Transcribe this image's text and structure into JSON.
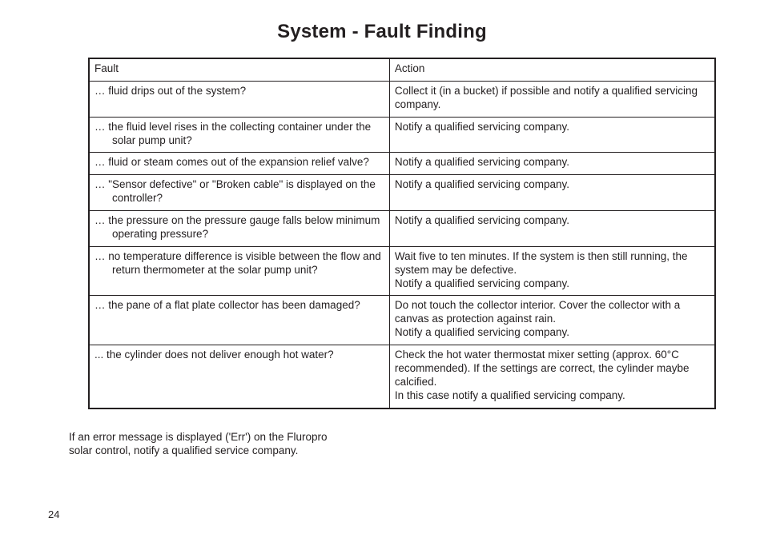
{
  "title": "System - Fault Finding",
  "columns": {
    "fault": "Fault",
    "action": "Action"
  },
  "rows": [
    {
      "fault": "… fluid drips out of the system?",
      "action": "Collect it (in a bucket) if possible and notify a qualified servicing company."
    },
    {
      "fault": "… the fluid level rises in the collecting container under the solar pump unit?",
      "action": "Notify a qualified servicing company."
    },
    {
      "fault": "… fluid or steam comes out of the expansion relief valve?",
      "action": "Notify a qualified servicing company."
    },
    {
      "fault": "… \"Sensor defective\" or \"Broken cable\" is displayed on the controller?",
      "action": "Notify a qualified servicing company."
    },
    {
      "fault": "… the pressure on the pressure gauge falls below minimum operating pressure?",
      "action": "Notify a qualified servicing company."
    },
    {
      "fault": "… no temperature difference is visible between the flow and return thermometer at the solar pump unit?",
      "action": "Wait five to ten minutes. If the system is then still running, the system may be defective.\nNotify a qualified servicing company."
    },
    {
      "fault": "… the pane of a flat plate collector has been damaged?",
      "action": "Do not touch the collector interior. Cover the collector with a canvas as protection against rain.\nNotify a qualified servicing company."
    },
    {
      "fault": "... the cylinder does not deliver enough hot water?",
      "action": "Check  the hot water thermostat mixer setting (approx. 60°C recommended). If the settings are correct, the cylinder maybe calcified.\nIn this case notify a qualified servicing company."
    }
  ],
  "note_line1": "If an error message is displayed ('Err') on the Fluropro",
  "note_line2": "solar control, notify a qualified service company.",
  "page_number": "24"
}
